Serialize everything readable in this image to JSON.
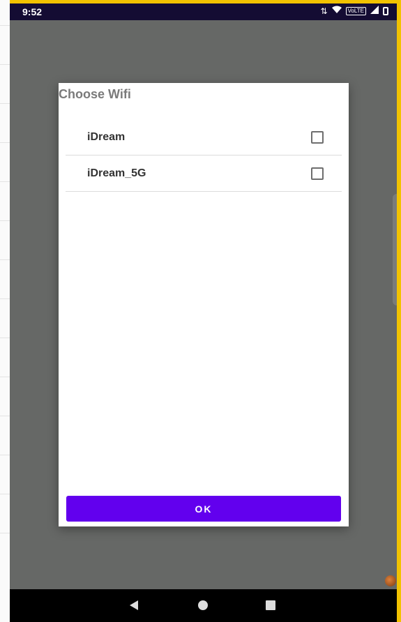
{
  "status_bar": {
    "time": "9:52",
    "volte_label": "VoLTE",
    "icons": [
      "data-arrows-icon",
      "wifi-icon",
      "volte-icon",
      "signal-icon",
      "battery-icon"
    ]
  },
  "dialog": {
    "title": "Choose Wifi",
    "networks": [
      {
        "name": "iDream",
        "checked": false
      },
      {
        "name": "iDream_5G",
        "checked": false
      }
    ],
    "ok_label": "OK"
  },
  "nav_bar": {
    "icons": [
      "back-icon",
      "home-icon",
      "recents-icon"
    ]
  },
  "colors": {
    "status_bar": "#140c33",
    "scrim": "#666866",
    "accent": "#6200ee",
    "frame_accent": "#f2c200"
  }
}
